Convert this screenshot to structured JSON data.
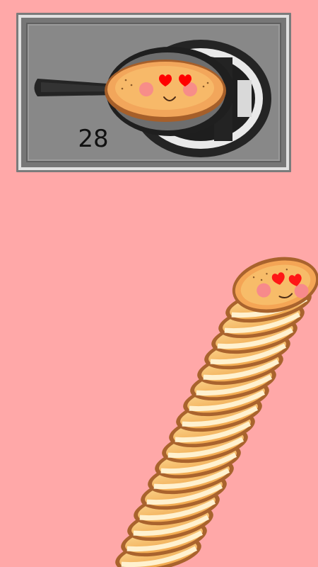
{
  "game": {
    "score": "28",
    "background_color": "#ffa8a8"
  },
  "preview": {
    "pan_icon": "frying-pan-icon",
    "pancake_face": "heart-eyes-smile"
  },
  "stack": {
    "pancake_count": 28,
    "top_face": "heart-eyes-smile"
  }
}
